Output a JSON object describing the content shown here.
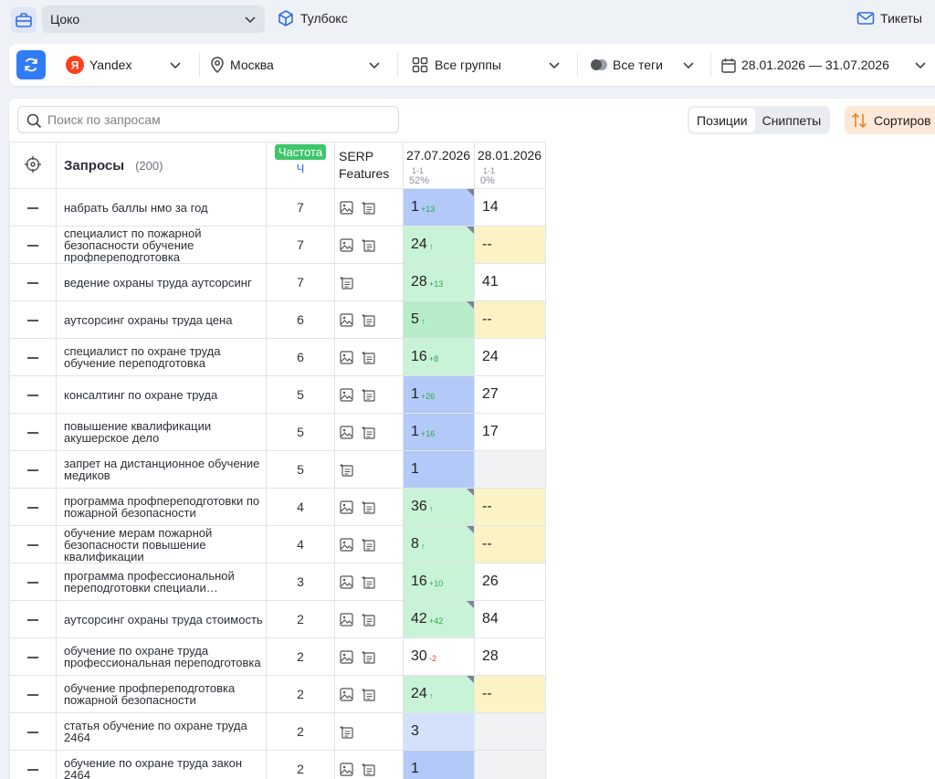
{
  "topbar": {
    "project": "Цоко",
    "toolbox": "Тулбокс",
    "tickets": "Тикеты"
  },
  "filters": {
    "engine": "Yandex",
    "region": "Москва",
    "groups": "Все группы",
    "tags": "Все теги",
    "dates": "28.01.2026 — 31.07.2026"
  },
  "search": {
    "placeholder": "Поиск по запросам"
  },
  "tabs": {
    "positions": "Позиции",
    "snippets": "Сниппеты"
  },
  "sort_label": "Сортиров",
  "header": {
    "queries": "Запросы",
    "count": "(200)",
    "freq_badge": "Частота",
    "freq_sub": "Ч",
    "serp_line1": "SERP",
    "serp_line2": "Features",
    "date1": "27.07.2026",
    "date1_sub": "1-1",
    "date1_pct": "52%",
    "date2": "28.01.2026",
    "date2_sub": "1-1",
    "date2_pct": "0%"
  },
  "rows": [
    {
      "q": "набрать баллы нмо за год",
      "f": "7",
      "serp": [
        "image",
        "snippet"
      ],
      "p1": "1",
      "d1": "+13",
      "dir": "up",
      "c1": "blue",
      "corner": true,
      "p2": "14",
      "c2": "white"
    },
    {
      "q": "специалист по пожарной безопасности обучение профпереподготовка",
      "f": "7",
      "serp": [
        "image",
        "snippet"
      ],
      "p1": "24",
      "d1": "↑",
      "dir": "up",
      "c1": "green",
      "corner": true,
      "p2": "--",
      "c2": "yellow"
    },
    {
      "q": "ведение охраны труда аутсорсинг",
      "f": "7",
      "serp": [
        "snippet"
      ],
      "p1": "28",
      "d1": "+13",
      "dir": "up",
      "c1": "green",
      "corner": false,
      "p2": "41",
      "c2": "white"
    },
    {
      "q": "аутсорсинг охраны труда цена",
      "f": "6",
      "serp": [
        "image",
        "snippet"
      ],
      "p1": "5",
      "d1": "↑",
      "dir": "up",
      "c1": "dgreen",
      "corner": true,
      "p2": "--",
      "c2": "yellow"
    },
    {
      "q": "специалист по охране труда обучение переподготовка",
      "f": "6",
      "serp": [
        "image",
        "snippet"
      ],
      "p1": "16",
      "d1": "+8",
      "dir": "up",
      "c1": "green",
      "corner": false,
      "p2": "24",
      "c2": "white"
    },
    {
      "q": "консалтинг по охране труда",
      "f": "5",
      "serp": [
        "image",
        "snippet"
      ],
      "p1": "1",
      "d1": "+26",
      "dir": "up",
      "c1": "blue",
      "corner": false,
      "p2": "27",
      "c2": "white"
    },
    {
      "q": "повышение квалификации акушерское дело",
      "f": "5",
      "serp": [
        "image",
        "snippet"
      ],
      "p1": "1",
      "d1": "+16",
      "dir": "up",
      "c1": "blue",
      "corner": false,
      "p2": "17",
      "c2": "white"
    },
    {
      "q": "запрет на дистанционное обучение медиков",
      "f": "5",
      "serp": [
        "snippet"
      ],
      "p1": "1",
      "d1": "",
      "dir": "up",
      "c1": "blue",
      "corner": false,
      "p2": "",
      "c2": "grey"
    },
    {
      "q": "программа профпереподготовки по пожарной безопасности",
      "f": "4",
      "serp": [
        "image",
        "snippet"
      ],
      "p1": "36",
      "d1": "↑",
      "dir": "up",
      "c1": "green",
      "corner": true,
      "p2": "--",
      "c2": "yellow"
    },
    {
      "q": "обучение мерам пожарной безопасности повышение квалификации",
      "f": "4",
      "serp": [
        "image",
        "snippet"
      ],
      "p1": "8",
      "d1": "↑",
      "dir": "up",
      "c1": "green",
      "corner": true,
      "p2": "--",
      "c2": "yellow"
    },
    {
      "q": "программа профессиональной переподготовки специали…",
      "f": "3",
      "serp": [
        "image",
        "snippet"
      ],
      "p1": "16",
      "d1": "+10",
      "dir": "up",
      "c1": "green",
      "corner": false,
      "p2": "26",
      "c2": "white"
    },
    {
      "q": "аутсорсинг охраны труда стоимость",
      "f": "2",
      "serp": [
        "image",
        "snippet"
      ],
      "p1": "42",
      "d1": "+42",
      "dir": "up",
      "c1": "green",
      "corner": true,
      "p2": "84",
      "c2": "white"
    },
    {
      "q": "обучение по охране труда профессиональная переподготовка",
      "f": "2",
      "serp": [
        "image",
        "snippet"
      ],
      "p1": "30",
      "d1": "-2",
      "dir": "down",
      "c1": "white",
      "corner": false,
      "p2": "28",
      "c2": "white"
    },
    {
      "q": "обучение профпереподготовка пожарной безопасности",
      "f": "2",
      "serp": [
        "image",
        "snippet"
      ],
      "p1": "24",
      "d1": "↑",
      "dir": "up",
      "c1": "green",
      "corner": true,
      "p2": "--",
      "c2": "yellow"
    },
    {
      "q": "статья обучение по охране труда 2464",
      "f": "2",
      "serp": [
        "snippet"
      ],
      "p1": "3",
      "d1": "",
      "dir": "up",
      "c1": "lblue",
      "corner": false,
      "p2": "",
      "c2": "grey"
    },
    {
      "q": "обучение по охране труда закон 2464",
      "f": "2",
      "serp": [
        "image",
        "snippet"
      ],
      "p1": "1",
      "d1": "",
      "dir": "up",
      "c1": "blue",
      "corner": false,
      "p2": "",
      "c2": "grey"
    }
  ]
}
